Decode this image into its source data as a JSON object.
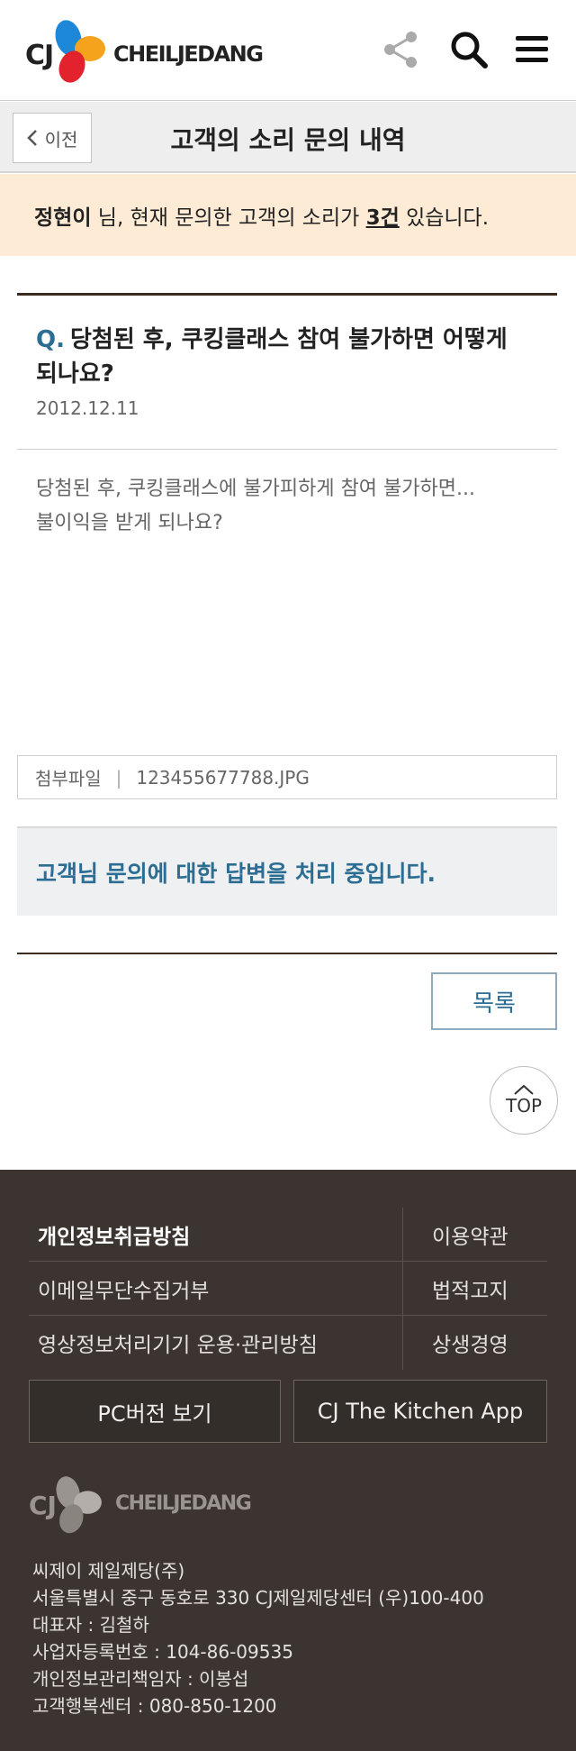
{
  "header": {
    "logo_cj": "CJ",
    "logo_name": "CHEILJEDANG",
    "share_icon": "share-icon",
    "search_icon": "search-icon",
    "menu_icon": "hamburger-menu-icon"
  },
  "subheader": {
    "back_label": "이전",
    "title": "고객의 소리 문의 내역"
  },
  "notice": {
    "user_name": "정현이",
    "text_before_count": " 님, 현재 문의한 고객의 소리가 ",
    "count": "3건",
    "text_after_count": " 있습니다."
  },
  "question": {
    "prefix": "Q.",
    "title": "당첨된 후, 쿠킹클래스 참여 불가하면 어떻게 되나요?",
    "date": "2012.12.11",
    "body_line1": "당첨된 후, 쿠킹클래스에 불가피하게 참여 불가하면...",
    "body_line2": "불이익을 받게 되나요?"
  },
  "attachment": {
    "label": "첨부파일",
    "separator": "|",
    "filename": "123455677788.JPG"
  },
  "answer": {
    "status": "고객님 문의에 대한 답변을 처리 중입니다."
  },
  "actions": {
    "list_label": "목록",
    "top_label": "TOP"
  },
  "footer": {
    "links": [
      {
        "left": "개인정보취급방침",
        "right": "이용약관"
      },
      {
        "left": "이메일무단수집거부",
        "right": "법적고지"
      },
      {
        "left": "영상정보처리기기 운용·관리방침",
        "right": "상생경영"
      }
    ],
    "pc_button": "PC버전 보기",
    "app_button": "CJ The Kitchen App",
    "logo_cj": "CJ",
    "logo_name": "CHEILJEDANG",
    "company": "씨제이 제일제당(주)",
    "address": "서울특별시 중구 동호로 330 CJ제일제당센터 (우)100-400",
    "ceo": "대표자 : 김철하",
    "biz_no": "사업자등록번호 : 104-86-09535",
    "privacy_officer": "개인정보관리책임자 : 이봉섭",
    "cs_center": "고객행복센터 : 080-850-1200"
  },
  "colors": {
    "accent_blue": "#2b6d93",
    "notice_bg": "#fdebd6",
    "footer_bg": "#3b3430",
    "brand_dark": "#3b2c22",
    "logo_blue": "#1e88d8",
    "logo_orange": "#f5a21c",
    "logo_red": "#e2222c"
  }
}
